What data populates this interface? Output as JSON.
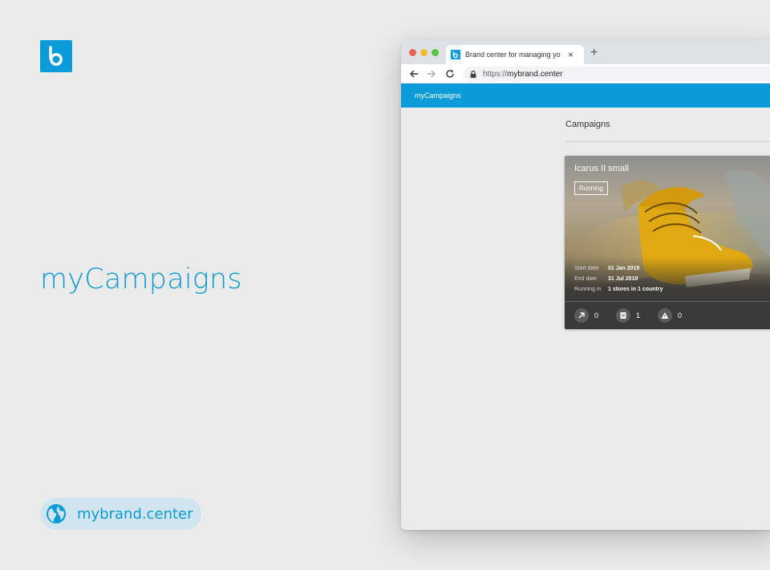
{
  "brand": {
    "logo_letter": "b",
    "color": "#0a9bd8"
  },
  "hero": {
    "title": "myCampaigns"
  },
  "site_pill": {
    "url": "mybrand.center"
  },
  "browser": {
    "tab_title": "Brand center for managing yo",
    "url_scheme": "https://",
    "url_host": "mybrand.center"
  },
  "app": {
    "title": "myCampaigns",
    "section_title": "Campaigns"
  },
  "campaign": {
    "name": "Icarus II small",
    "status": "Running",
    "start_label": "Start date",
    "start_value": "01 Jan 2019",
    "end_label": "End date",
    "end_value": "31 Jul 2019",
    "running_label": "Running in",
    "running_value": "1 stores in 1 country",
    "stats": [
      {
        "icon": "trend-arrow-icon",
        "value": "0"
      },
      {
        "icon": "document-icon",
        "value": "1"
      },
      {
        "icon": "warning-icon",
        "value": "0"
      }
    ]
  }
}
